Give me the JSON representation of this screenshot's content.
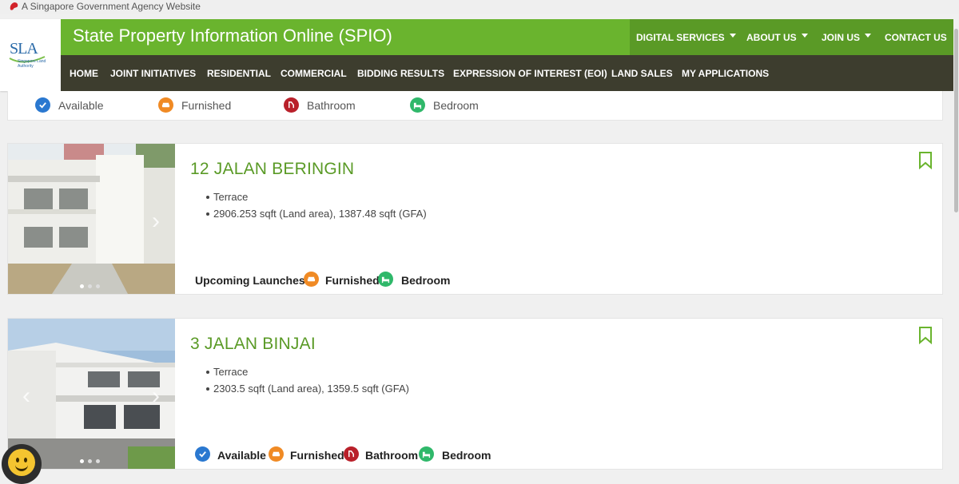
{
  "agency_bar": {
    "text": "A Singapore Government Agency Website"
  },
  "logo": {
    "text": "SLA",
    "subtext": "Singapore Land Authority"
  },
  "site_title": "State Property Information Online (SPIO)",
  "top_menu": [
    {
      "label": "DIGITAL SERVICES",
      "dropdown": true
    },
    {
      "label": "ABOUT US",
      "dropdown": true
    },
    {
      "label": "JOIN US",
      "dropdown": true
    },
    {
      "label": "CONTACT US",
      "dropdown": false
    }
  ],
  "nav": [
    {
      "label": "HOME"
    },
    {
      "label": "JOINT INITIATIVES"
    },
    {
      "label": "RESIDENTIAL"
    },
    {
      "label": "COMMERCIAL"
    },
    {
      "label": "BIDDING RESULTS"
    },
    {
      "label": "EXPRESSION OF INTEREST (EOI)"
    },
    {
      "label": "LAND SALES"
    },
    {
      "label": "MY APPLICATIONS"
    }
  ],
  "legend": [
    {
      "icon": "check-icon",
      "label": "Available"
    },
    {
      "icon": "sofa-icon",
      "label": "Furnished"
    },
    {
      "icon": "bathtub-icon",
      "label": "Bathroom"
    },
    {
      "icon": "bed-icon",
      "label": "Bedroom"
    }
  ],
  "listings": [
    {
      "title": "12 JALAN BERINGIN",
      "details": [
        "Terrace",
        "2906.253 sqft (Land area), 1387.48 sqft (GFA)"
      ],
      "tags": [
        {
          "icon": null,
          "label": "Upcoming Launches"
        },
        {
          "icon": "sofa-icon",
          "label": "Furnished"
        },
        {
          "icon": "bed-icon",
          "label": "Bedroom"
        }
      ]
    },
    {
      "title": "3 JALAN BINJAI",
      "details": [
        "Terrace",
        "2303.5 sqft (Land area), 1359.5 sqft (GFA)"
      ],
      "tags": [
        {
          "icon": "check-icon",
          "label": "Available"
        },
        {
          "icon": "sofa-icon",
          "label": "Furnished"
        },
        {
          "icon": "bathtub-icon",
          "label": "Bathroom"
        },
        {
          "icon": "bed-icon",
          "label": "Bedroom"
        }
      ]
    }
  ],
  "colors": {
    "brand_green": "#6ab42e",
    "menu_green": "#5a9a26",
    "nav_dark": "#3d3d2e",
    "available_blue": "#2a78d0",
    "furnished_orange": "#f08a24",
    "bathroom_red": "#b9202a",
    "bedroom_green": "#2fb86a"
  }
}
